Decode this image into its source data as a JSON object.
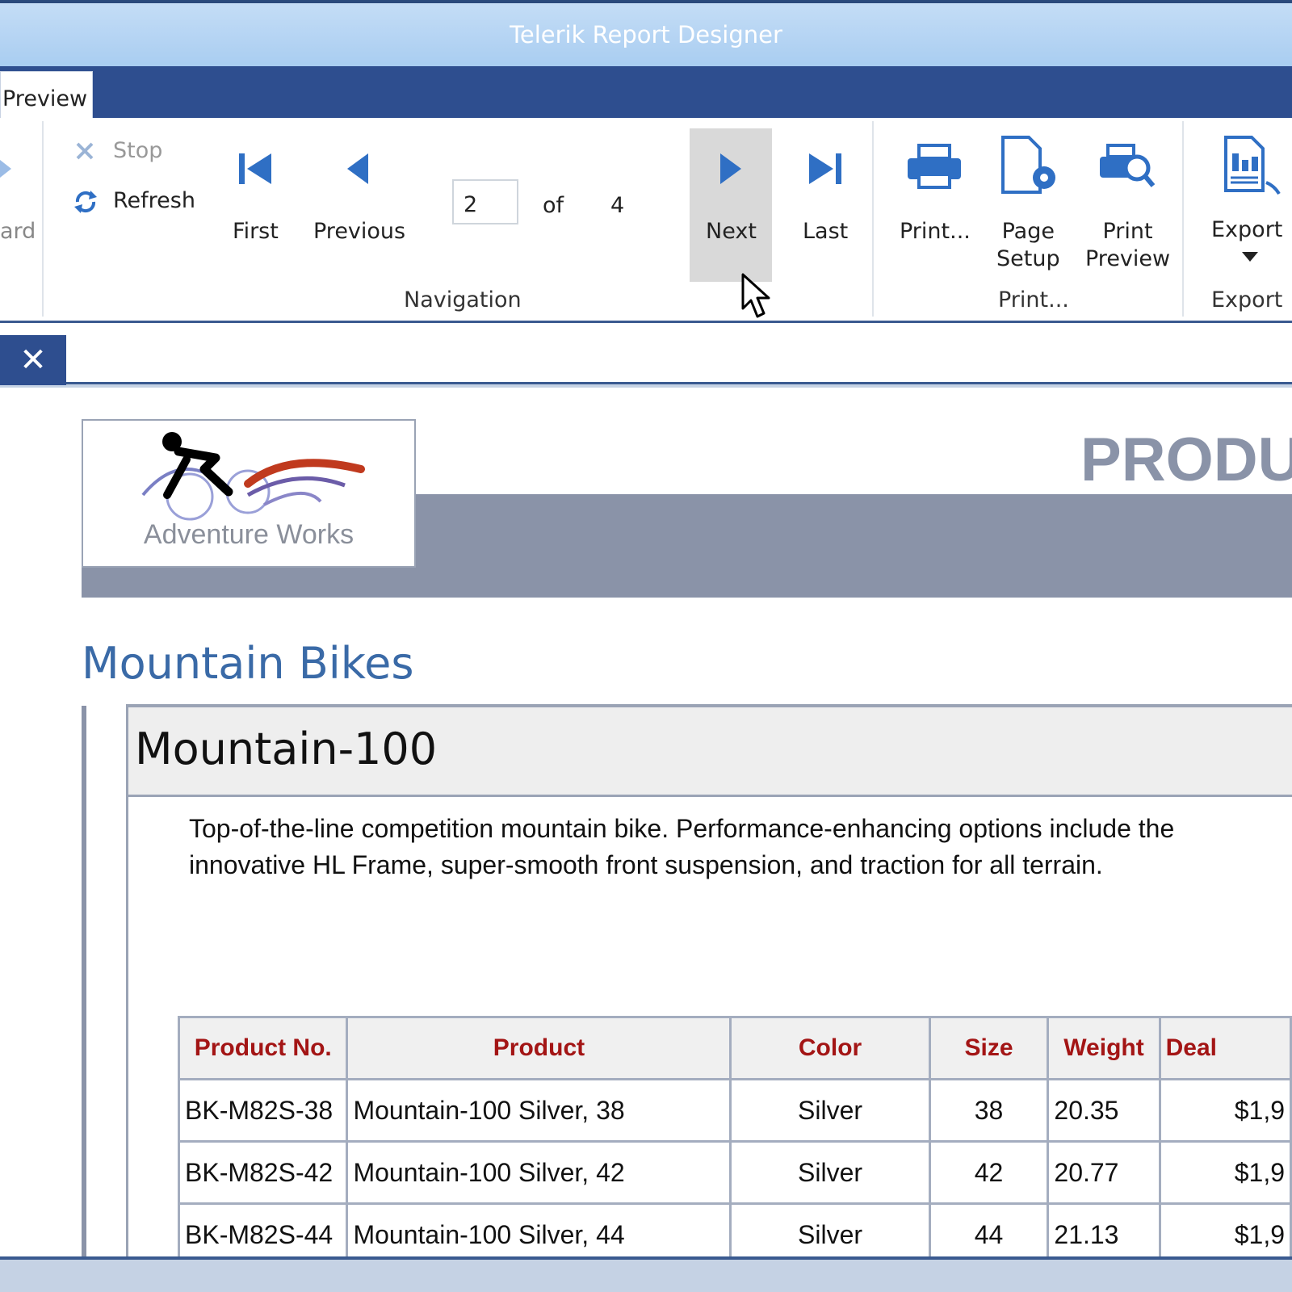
{
  "window": {
    "title": "Telerik Report Designer"
  },
  "tabs": {
    "active": "Preview"
  },
  "ribbon": {
    "wizard_partial": "ard",
    "stop_label": "Stop",
    "refresh_label": "Refresh",
    "first_label": "First",
    "previous_label": "Previous",
    "page_current": "2",
    "of_label": "of",
    "page_total": "4",
    "next_label": "Next",
    "last_label": "Last",
    "navigation_group": "Navigation",
    "print_label": "Print...",
    "page_setup_line1": "Page",
    "page_setup_line2": "Setup",
    "print_preview_line1": "Print",
    "print_preview_line2": "Preview",
    "print_group": "Print...",
    "export_label": "Export",
    "export_group": "Export"
  },
  "colors": {
    "accent": "#2e4e8f",
    "icon_blue": "#2f6fc4",
    "header_red": "#a31515",
    "band_gray": "#8a93a8"
  },
  "report": {
    "logo_text": "Adventure Works",
    "title_partial": "PRODU",
    "category": "Mountain Bikes",
    "product_name": "Mountain-100",
    "description": "Top-of-the-line competition mountain bike. Performance-enhancing options include the innovative HL Frame, super-smooth front suspension, and traction for all terrain.",
    "table": {
      "headers": [
        "Product No.",
        "Product",
        "Color",
        "Size",
        "Weight",
        "Deal"
      ],
      "rows": [
        [
          "BK-M82S-38",
          "Mountain-100 Silver, 38",
          "Silver",
          "38",
          "20.35",
          "$1,9"
        ],
        [
          "BK-M82S-42",
          "Mountain-100 Silver, 42",
          "Silver",
          "42",
          "20.77",
          "$1,9"
        ],
        [
          "BK-M82S-44",
          "Mountain-100 Silver, 44",
          "Silver",
          "44",
          "21.13",
          "$1,9"
        ]
      ]
    }
  }
}
